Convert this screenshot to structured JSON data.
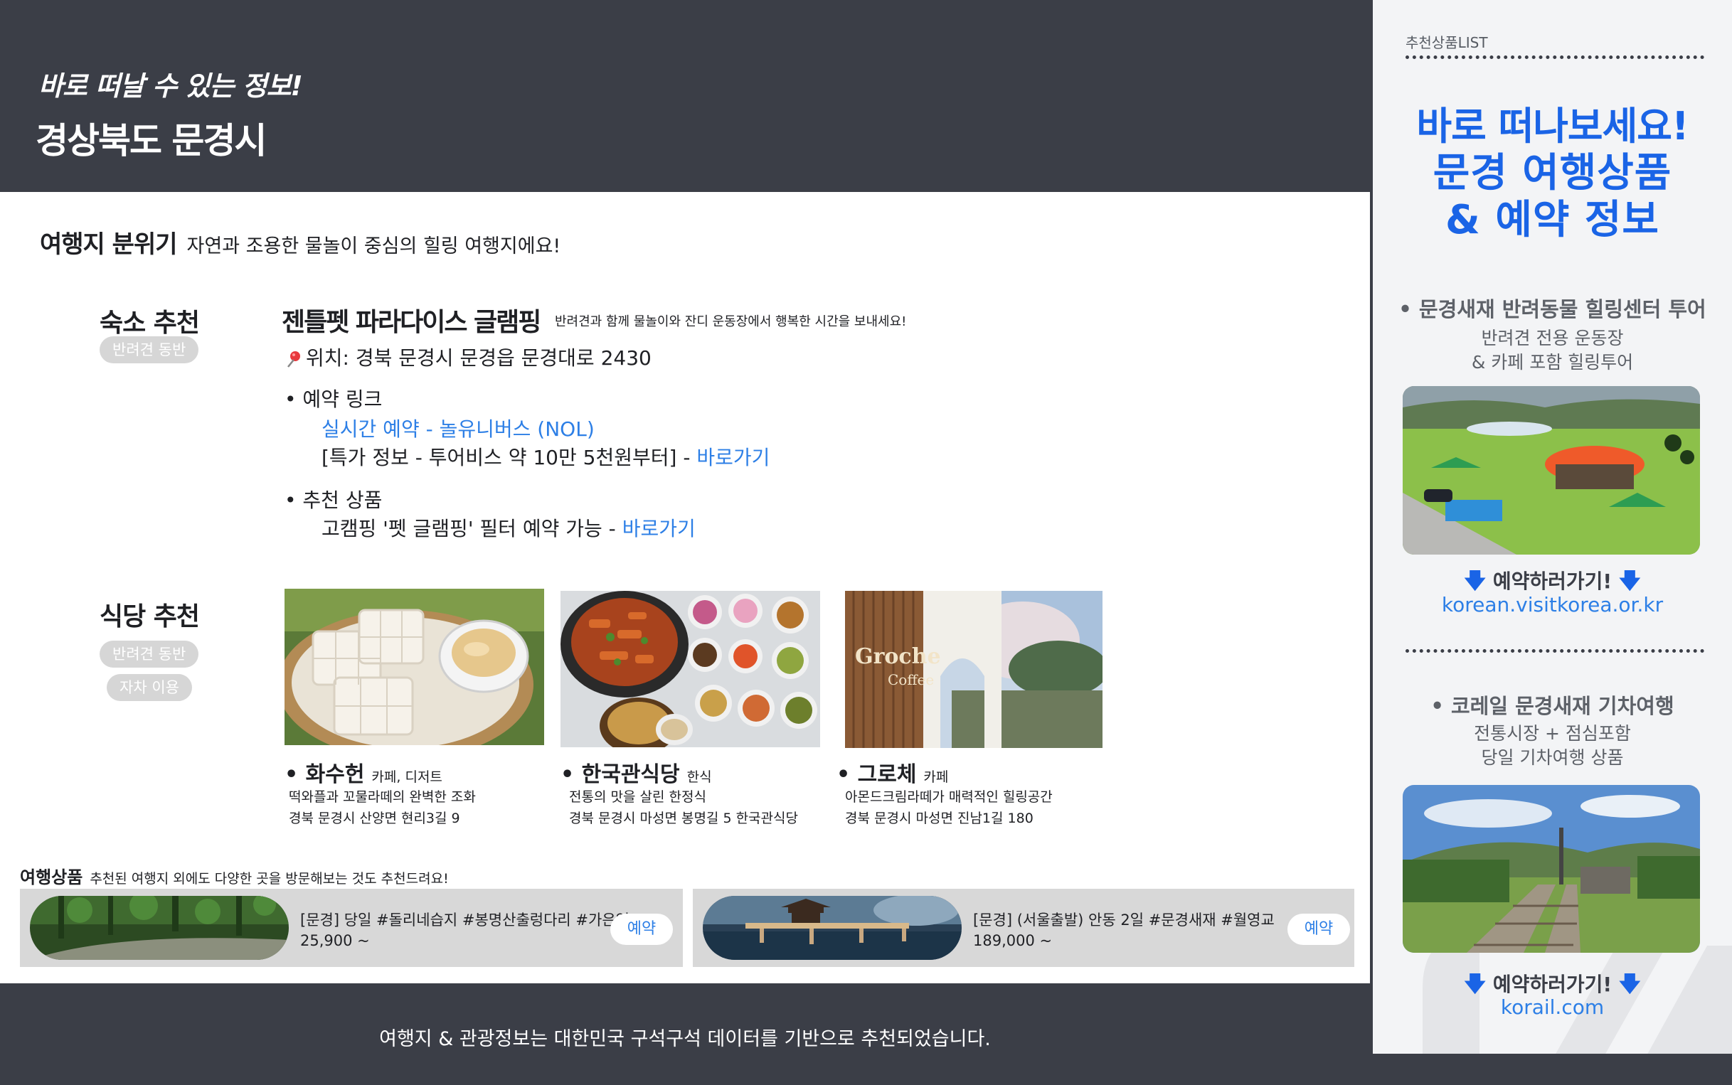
{
  "header": {
    "subtitle": "바로 떠날 수 있는 정보!",
    "title": "경상북도 문경시"
  },
  "mood": {
    "label": "여행지 분위기",
    "text": "자연과 조용한 물놀이 중심의 힐링 여행지에요!"
  },
  "stay": {
    "section_title": "숙소 추천",
    "tag": "반려견 동반",
    "name": "젠틀펫 파라다이스 글램핑",
    "desc": "반려견과 함께 물놀이와 잔디 운동장에서 행복한 시간을 보내세요!",
    "location": "위치: 경북 문경시 문경읍 문경대로 2430",
    "booking_header": "• 예약 링크",
    "booking_link": "실시간 예약 - 놀유니버스 (NOL)",
    "special_text": "[특가 정보 - 투어비스 약 10만 5천원부터] - ",
    "special_link": "바로가기",
    "product_header": "• 추천 상품",
    "product_text": "고캠핑 '펫 글램핑' 필터 예약 가능 - ",
    "product_link": "바로가기"
  },
  "restaurants": {
    "section_title": "식당 추천",
    "tags": [
      "반려견 동반",
      "자차 이용"
    ],
    "items": [
      {
        "name": "• 화수헌",
        "category": "카페, 디저트",
        "desc": "떡와플과 꼬물라떼의 완벽한 조화",
        "address": "경북 문경시 산양면 현리3길 9"
      },
      {
        "name": "• 한국관식당",
        "category": "한식",
        "desc": "전통의 맛을 살린 한정식",
        "address": "경북 문경시 마성면 봉명길 5 한국관식당"
      },
      {
        "name": "• 그로체",
        "category": "카페",
        "desc": "아몬드크림라떼가 매력적인 힐링공간",
        "address": "경북 문경시 마성면 진남1길 180"
      }
    ],
    "sign_text": "Groche",
    "sign_sub": "Coffee"
  },
  "products": {
    "label": "여행상품",
    "desc": "추천된 여행지 외에도 다양한 곳을 방문해보는 것도 추천드려요!",
    "items": [
      {
        "title": "[문경] 당일 #돌리네습지 #봉명산출렁다리 #가은역",
        "price": "25,900 ~",
        "button": "예약"
      },
      {
        "title": "[문경] (서울출발) 안동 2일 #문경새재 #월영교",
        "price": "189,000 ~",
        "button": "예약"
      }
    ]
  },
  "footer": {
    "text": "여행지 & 관광정보는 대한민국 구석구석 데이터를 기반으로 추천되었습니다."
  },
  "sidebar": {
    "list_label": "추천상품LIST",
    "hero_line1": "바로 떠나보세요!",
    "hero_line2": "문경 여행상품",
    "hero_line3": "& 예약 정보",
    "items": [
      {
        "title": "• 문경새재 반려동물 힐링센터 투어",
        "desc1": "반려견 전용 운동장",
        "desc2": "& 카페 포함 힐링투어",
        "go": "예약하러가기!",
        "url": "korean.visitkorea.or.kr"
      },
      {
        "title": "• 코레일 문경새재 기차여행",
        "desc1": "전통시장 + 점심포함",
        "desc2": "당일 기차여행 상품",
        "go": "예약하러가기!",
        "url": "korail.com"
      }
    ]
  },
  "colors": {
    "header_bg": "#3b3e47",
    "accent_blue": "#1a64e6",
    "link_blue": "#2d7fe6",
    "pill_gray": "#d6d6d6",
    "card_gray": "#d8d8d8"
  },
  "icons": {
    "location": "pin-icon",
    "arrow": "arrow-down-icon"
  }
}
